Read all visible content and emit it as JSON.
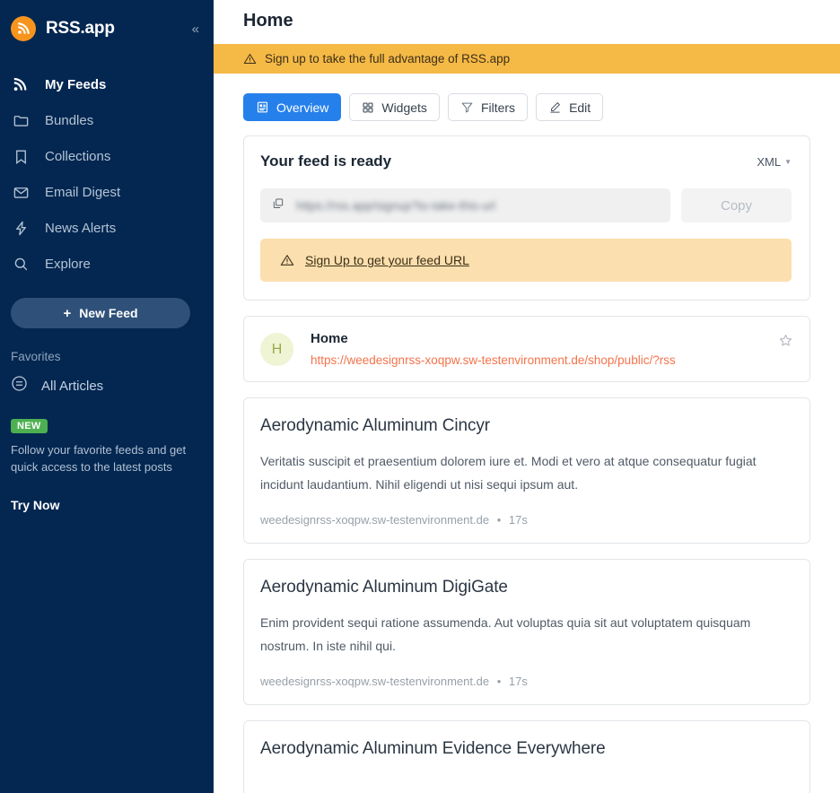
{
  "sidebar": {
    "brand": "RSS.app",
    "logo_icon": "rss-icon",
    "collapse_icon": "chevron-double-left-icon",
    "nav": [
      {
        "label": "My Feeds",
        "icon": "rss-icon",
        "active": true
      },
      {
        "label": "Bundles",
        "icon": "folder-icon",
        "active": false
      },
      {
        "label": "Collections",
        "icon": "bookmark-icon",
        "active": false
      },
      {
        "label": "Email Digest",
        "icon": "envelope-icon",
        "active": false
      },
      {
        "label": "News Alerts",
        "icon": "bolt-icon",
        "active": false
      },
      {
        "label": "Explore",
        "icon": "search-icon",
        "active": false
      }
    ],
    "new_feed_button": "New Feed",
    "new_feed_plus": "+",
    "favorites_heading": "Favorites",
    "all_articles": "All Articles",
    "all_articles_icon": "circle-list-icon",
    "new_badge": "NEW",
    "promo_text": "Follow your favorite feeds and get quick access to the latest posts",
    "try_now": "Try Now",
    "colors": {
      "background": "#042751",
      "accent_orange": "#f7941e",
      "badge_green": "#4cb050",
      "button": "#2f5179"
    }
  },
  "header": {
    "title": "Home",
    "alert_banner": {
      "text": "Sign up to take the full advantage of RSS.app",
      "icon": "warning-triangle-icon",
      "color": "#f5b946"
    }
  },
  "tabs": [
    {
      "label": "Overview",
      "icon": "overview-icon",
      "active": true
    },
    {
      "label": "Widgets",
      "icon": "grid-icon",
      "active": false
    },
    {
      "label": "Filters",
      "icon": "funnel-icon",
      "active": false
    },
    {
      "label": "Edit",
      "icon": "pencil-icon",
      "active": false
    }
  ],
  "feed_ready": {
    "title": "Your feed is ready",
    "format": "XML",
    "format_caret_icon": "chevron-down-icon",
    "copy_icon": "copy-icon",
    "url_value": "https://rss.app/signup?to-take-this-url",
    "copy_button": "Copy",
    "signup_notice": "Sign Up to get your feed URL",
    "signup_icon": "warning-triangle-icon"
  },
  "feed_info": {
    "avatar_letter": "H",
    "title": "Home",
    "url": "https://weedesignrss-xoqpw.sw-testenvironment.de/shop/public/?rss",
    "star_icon": "star-outline-icon"
  },
  "articles": [
    {
      "title": "Aerodynamic Aluminum Cincyr",
      "description": "Veritatis suscipit et praesentium dolorem iure et. Modi et vero at atque consequatur fugiat incidunt laudantium. Nihil eligendi ut nisi sequi ipsum aut.",
      "source": "weedesignrss-xoqpw.sw-testenvironment.de",
      "time": "17s",
      "separator": "•"
    },
    {
      "title": "Aerodynamic Aluminum DigiGate",
      "description": "Enim provident sequi ratione assumenda. Aut voluptas quia sit aut voluptatem quisquam nostrum. In iste nihil qui.",
      "source": "weedesignrss-xoqpw.sw-testenvironment.de",
      "time": "17s",
      "separator": "•"
    },
    {
      "title": "Aerodynamic Aluminum Evidence Everywhere",
      "description": "",
      "source": "",
      "time": "",
      "separator": ""
    }
  ]
}
